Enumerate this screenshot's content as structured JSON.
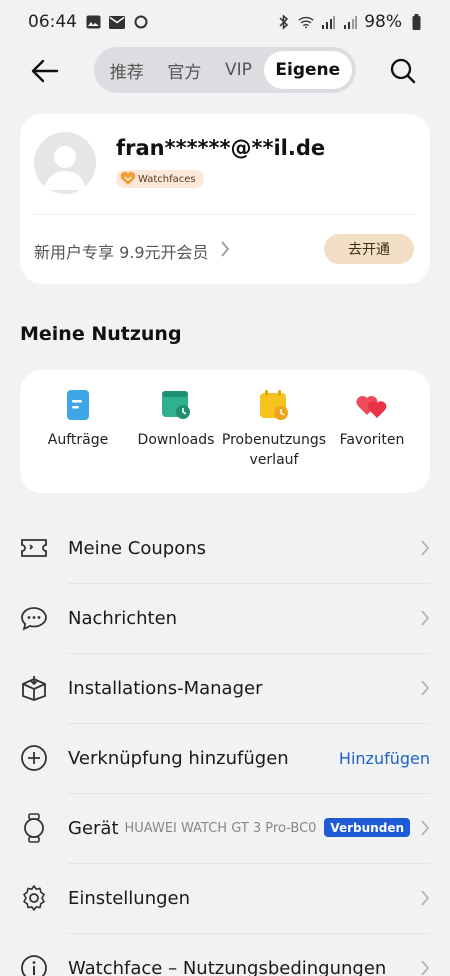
{
  "status": {
    "time": "06:44",
    "battery": "98%"
  },
  "header": {
    "tabs": [
      {
        "label": "推荐"
      },
      {
        "label": "官方"
      },
      {
        "label": "VIP"
      },
      {
        "label": "Eigene"
      }
    ],
    "active_tab": 3
  },
  "profile": {
    "username": "fran******@**il.de",
    "badge": "Watchfaces",
    "promo": "新用户专享 9.9元开会员",
    "open_button": "去开通"
  },
  "usage": {
    "title": "Meine Nutzung",
    "items": [
      {
        "label": "Aufträge",
        "icon": "orders-icon"
      },
      {
        "label": "Downloads",
        "icon": "downloads-icon"
      },
      {
        "label": "Probenutzungs verlauf",
        "icon": "trial-history-icon"
      },
      {
        "label": "Favoriten",
        "icon": "favorites-icon"
      }
    ]
  },
  "menu": {
    "coupons": "Meine Coupons",
    "messages": "Nachrichten",
    "install_manager": "Installations-Manager",
    "shortcut": "Verknüpfung hinzufügen",
    "shortcut_action": "Hinzufügen",
    "device": "Gerät",
    "device_name": "HUAWEI WATCH GT 3 Pro-BC0",
    "device_status": "Verbunden",
    "settings": "Einstellungen",
    "terms": "Watchface – Nutzungsbedingungen"
  },
  "colors": {
    "accent_blue": "#1d63c7",
    "badge_bg": "#1f5bd6",
    "promo_btn": "#f2dfc6"
  }
}
